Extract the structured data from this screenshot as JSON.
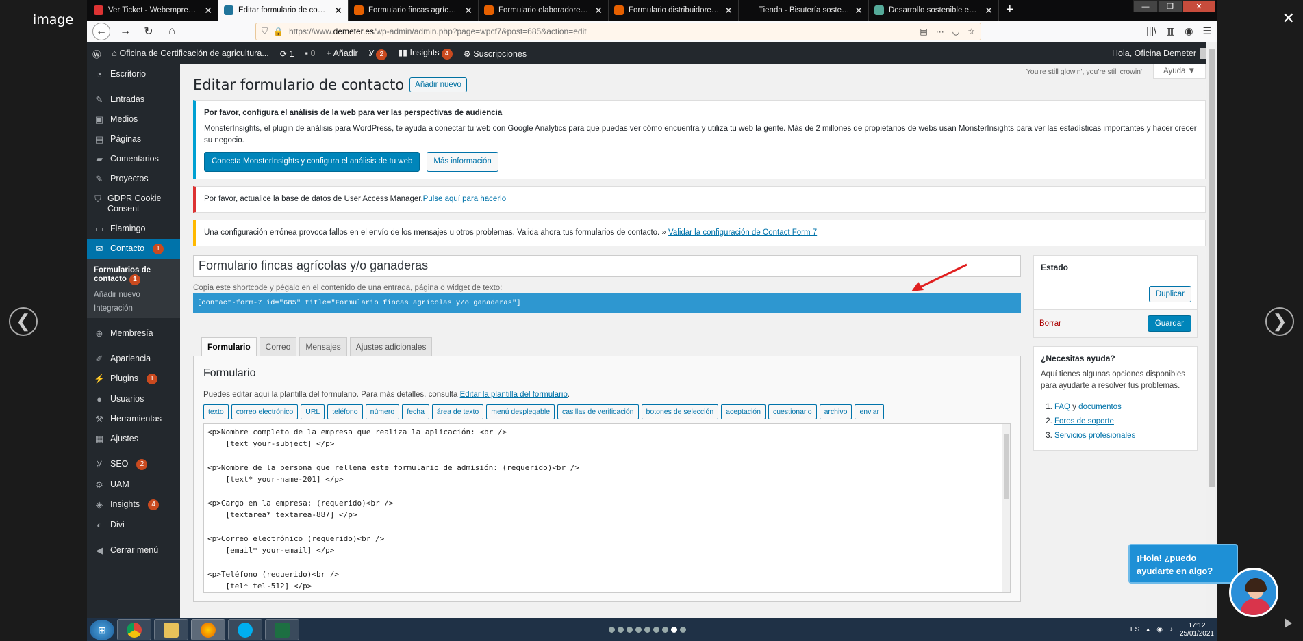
{
  "lightbox": {
    "title": "image",
    "close": "✕",
    "prev": "❮",
    "next": "❯"
  },
  "browser": {
    "tabs": [
      {
        "label": "Ver Ticket - Webempresa Europ",
        "color": "#d33"
      },
      {
        "label": "Editar formulario de contacto",
        "color": "#21759b",
        "active": true
      },
      {
        "label": "Formulario fincas agrícolas y/o",
        "color": "#e66000"
      },
      {
        "label": "Formulario elaboradores - Ofic",
        "color": "#e66000"
      },
      {
        "label": "Formulario distribuidores - Ofi",
        "color": "#e66000"
      },
      {
        "label": "Tienda - Bisutería sostenible",
        "color": "#0c0c0d"
      },
      {
        "label": "Desarrollo sostenible en la sierr",
        "color": "#5a9"
      }
    ],
    "new_tab": "+",
    "url_prefix": "https://www.",
    "url_domain": "demeter.es",
    "url_path": "/wp-admin/admin.php?page=wpcf7&post=685&action=edit"
  },
  "adminbar": {
    "site": "Oficina de Certificación de agricultura...",
    "updates": "1",
    "comments": "0",
    "add": "Añadir",
    "yoast_count": "2",
    "insights": "Insights",
    "insights_count": "4",
    "subs": "Suscripciones",
    "greeting": "Hola, Oficina Demeter"
  },
  "sidebar": {
    "items": [
      {
        "label": "Escritorio",
        "icon": "dashboard-icon"
      },
      {
        "label": "Entradas",
        "icon": "pin-icon"
      },
      {
        "label": "Medios",
        "icon": "media-icon"
      },
      {
        "label": "Páginas",
        "icon": "pages-icon"
      },
      {
        "label": "Comentarios",
        "icon": "comments-icon"
      },
      {
        "label": "Proyectos",
        "icon": "pin-icon"
      },
      {
        "label": "GDPR Cookie Consent",
        "icon": "shield-icon"
      },
      {
        "label": "Flamingo",
        "icon": "flamingo-icon"
      },
      {
        "label": "Contacto",
        "icon": "mail-icon",
        "badge": "1"
      },
      {
        "label": "Membresía",
        "icon": "globe-icon"
      },
      {
        "label": "Apariencia",
        "icon": "brush-icon"
      },
      {
        "label": "Plugins",
        "icon": "plugin-icon",
        "badge": "1"
      },
      {
        "label": "Usuarios",
        "icon": "user-icon"
      },
      {
        "label": "Herramientas",
        "icon": "wrench-icon"
      },
      {
        "label": "Ajustes",
        "icon": "settings-icon"
      },
      {
        "label": "SEO",
        "icon": "yoast-icon",
        "badge": "2"
      },
      {
        "label": "UAM",
        "icon": "uam-icon"
      },
      {
        "label": "Insights",
        "icon": "insights-icon",
        "badge": "4"
      },
      {
        "label": "Divi",
        "icon": "divi-icon"
      },
      {
        "label": "Cerrar menú",
        "icon": "collapse-icon"
      }
    ],
    "sub": {
      "forms": "Formularios de contacto",
      "forms_badge": "1",
      "add": "Añadir nuevo",
      "integration": "Integración"
    }
  },
  "screen": {
    "quote": "You're still glowin', you're still crowin'",
    "help": "Ayuda ▼"
  },
  "page": {
    "title": "Editar formulario de contacto",
    "add_new": "Añadir nuevo"
  },
  "notices": {
    "mi_title": "Por favor, configura el análisis de la web para ver las perspectivas de audiencia",
    "mi_text": "MonsterInsights, el plugin de análisis para WordPress, te ayuda a conectar tu web con Google Analytics para que puedas ver cómo encuentra y utiliza tu web la gente. Más de 2 millones de propietarios de webs usan MonsterInsights para ver las estadísticas importantes y hacer crecer su negocio.",
    "mi_btn": "Conecta MonsterInsights y configura el análisis de tu web",
    "mi_more": "Más información",
    "uam_text": "Por favor, actualice la base de datos de User Access Manager.",
    "uam_link": "Pulse aquí para hacerlo",
    "cf7_text": "Una configuración errónea provoca fallos en el envío de los mensajes u otros problemas. Valida ahora tus formularios de contacto. »",
    "cf7_link": "Validar la configuración de Contact Form 7"
  },
  "form": {
    "title": "Formulario fincas agrícolas y/o ganaderas",
    "shortcode_label": "Copia este shortcode y pégalo en el contenido de una entrada, página o widget de texto:",
    "shortcode": "[contact-form-7 id=\"685\" title=\"Formulario fincas agrícolas y/o ganaderas\"]",
    "tabs": [
      "Formulario",
      "Correo",
      "Mensajes",
      "Ajustes adicionales"
    ],
    "heading": "Formulario",
    "desc": "Puedes editar aquí la plantilla del formulario. Para más detalles, consulta",
    "desc_link": "Editar la plantilla del formulario",
    "tags": [
      "texto",
      "correo electrónico",
      "URL",
      "teléfono",
      "número",
      "fecha",
      "área de texto",
      "menú desplegable",
      "casillas de verificación",
      "botones de selección",
      "aceptación",
      "cuestionario",
      "archivo",
      "enviar"
    ],
    "code": "<p>Nombre completo de la empresa que realiza la aplicación: <br />\n    [text your-subject] </p>\n\n<p>Nombre de la persona que rellena este formulario de admisión: (requerido)<br />\n    [text* your-name-201] </p>\n\n<p>Cargo en la empresa: (requerido)<br />\n    [textarea* textarea-887] </p>\n\n<p>Correo electrónico (requerido)<br />\n    [email* your-email] </p>\n\n<p>Teléfono (requerido)<br />\n    [tel* tel-512] </p>"
  },
  "status_box": {
    "title": "Estado",
    "duplicate": "Duplicar",
    "delete": "Borrar",
    "save": "Guardar"
  },
  "help_box": {
    "title": "¿Necesitas ayuda?",
    "text": "Aquí tienes algunas opciones disponibles para ayudarte a resolver tus problemas.",
    "faq": "FAQ",
    "and": "y",
    "docs": "documentos",
    "forums": "Foros de soporte",
    "services": "Servicios profesionales"
  },
  "chat": {
    "text": "¡Hola! ¿puedo ayudarte en algo?"
  },
  "taskbar": {
    "lang": "ES",
    "time": "17:12",
    "date": "25/01/2021"
  },
  "colors": {
    "wp_blue": "#0073aa",
    "admin_dark": "#23282d",
    "badge": "#ca4a1f",
    "arrow": "#e02020"
  }
}
